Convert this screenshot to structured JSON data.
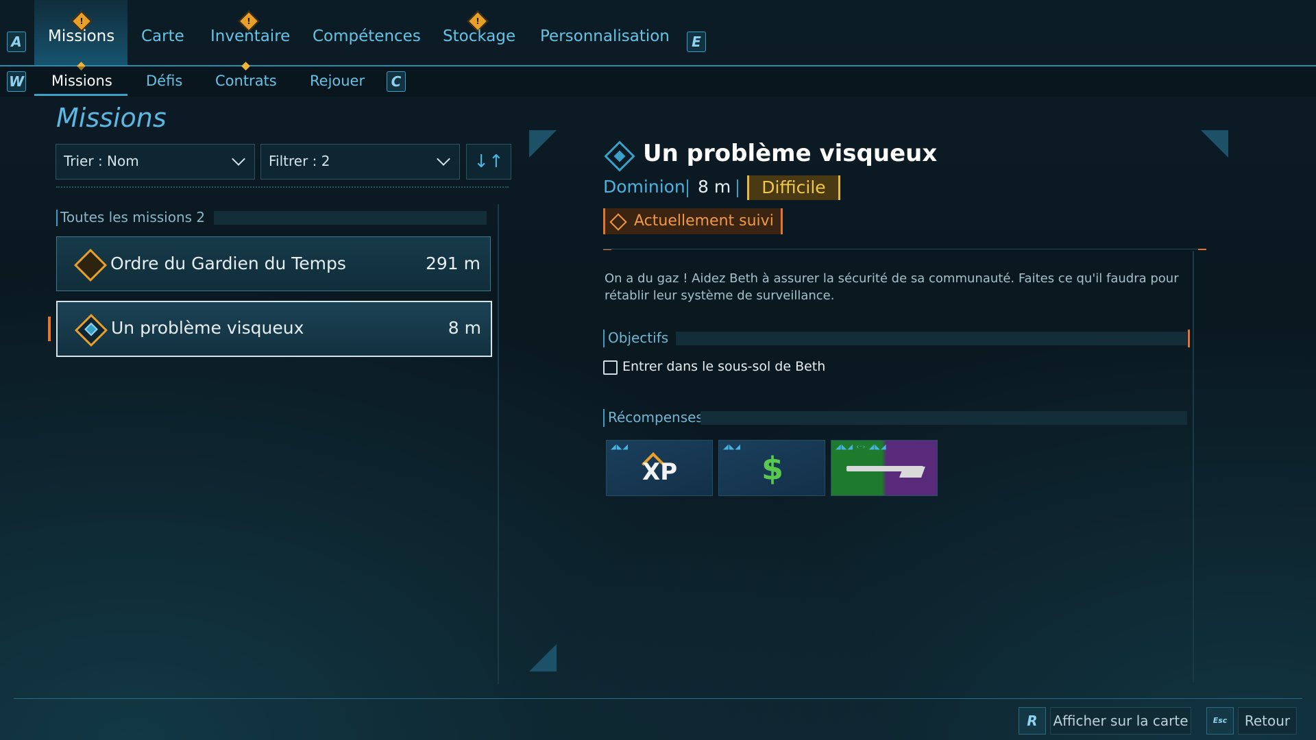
{
  "top_nav": {
    "left_key": "A",
    "right_key": "E",
    "tabs": [
      {
        "label": "Missions",
        "active": true,
        "alert": true
      },
      {
        "label": "Carte",
        "active": false,
        "alert": false
      },
      {
        "label": "Inventaire",
        "active": false,
        "alert": true
      },
      {
        "label": "Compétences",
        "active": false,
        "alert": false
      },
      {
        "label": "Stockage",
        "active": false,
        "alert": true
      },
      {
        "label": "Personnalisation",
        "active": false,
        "alert": false
      }
    ]
  },
  "sub_nav": {
    "left_key": "W",
    "right_key": "C",
    "tabs": [
      {
        "label": "Missions",
        "active": true
      },
      {
        "label": "Défis",
        "active": false
      },
      {
        "label": "Contrats",
        "active": false
      },
      {
        "label": "Rejouer",
        "active": false
      }
    ]
  },
  "left_panel": {
    "title": "Missions",
    "sort_label": "Trier : Nom",
    "filter_label": "Filtrer : 2",
    "section_label": "Toutes les missions 2",
    "missions": [
      {
        "name": "Ordre du Gardien du Temps",
        "distance": "291 m",
        "selected": false
      },
      {
        "name": "Un problème visqueux",
        "distance": "8 m",
        "selected": true
      }
    ]
  },
  "detail": {
    "title": "Un problème visqueux",
    "faction": "Dominion",
    "distance": "8 m",
    "difficulty": "Difficile",
    "tracked_label": "Actuellement suivi",
    "description": "On a du gaz ! Aidez Beth à assurer la sécurité de sa communauté. Faites ce qu'il faudra pour rétablir leur système de surveillance.",
    "objectives_label": "Objectifs",
    "objectives": [
      {
        "text": "Entrer dans le sous-sol de Beth",
        "done": false
      }
    ],
    "rewards_label": "Récompenses",
    "rewards": [
      {
        "type": "xp",
        "text": "XP",
        "icon": "xp-icon"
      },
      {
        "type": "money",
        "text": "$",
        "icon": "money-icon"
      },
      {
        "type": "weapon",
        "icon": "shotgun-icon"
      }
    ]
  },
  "footer": {
    "map_key": "R",
    "map_label": "Afficher sur la carte",
    "back_key": "Esc",
    "back_label": "Retour"
  },
  "colors": {
    "accent": "#3aa0c8",
    "alert": "#e7a12a",
    "difficulty": "#f0c650",
    "tracked": "#f09844",
    "reward_green": "#1e7a2c",
    "reward_purple": "#5a2a7a"
  }
}
